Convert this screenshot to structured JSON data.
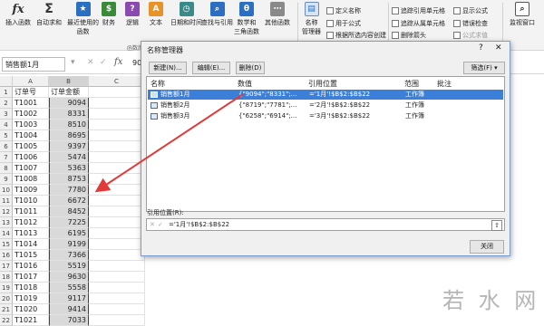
{
  "ribbon": {
    "insert_function": "插入函数",
    "autosum": "自动求和",
    "recent": "最近使用的\n函数",
    "financial": "财务",
    "logical": "逻辑",
    "text": "文本",
    "datetime": "日期和时间",
    "lookup": "查找与引用",
    "math": "数学和\n三角函数",
    "more": "其他函数",
    "name_manager": "名称\n管理器",
    "define_name": "定义名称",
    "use_in_formula": "用于公式",
    "create_from_selection": "根据所选内容创建",
    "trace_precedents": "追踪引用单元格",
    "trace_dependents": "追踪从属单元格",
    "remove_arrows": "删除箭头",
    "show_formulas": "显示公式",
    "error_checking": "错误检查",
    "evaluate_formula": "公式求值",
    "watch_window": "监视窗口",
    "group_library": "函数库",
    "fx": "fx",
    "sigma": "Σ"
  },
  "formula_bar": {
    "name_box": "销售额1月",
    "fx": "fx",
    "cancel": "✕",
    "enter": "✓",
    "value": "90"
  },
  "sheet": {
    "col_a": "A",
    "col_b": "B",
    "col_c": "C",
    "header_a": "订单号",
    "header_b": "订单金额",
    "rows": [
      {
        "id": "T1001",
        "amt": "9094"
      },
      {
        "id": "T1002",
        "amt": "8331"
      },
      {
        "id": "T1003",
        "amt": "8510"
      },
      {
        "id": "T1004",
        "amt": "8695"
      },
      {
        "id": "T1005",
        "amt": "9397"
      },
      {
        "id": "T1006",
        "amt": "5474"
      },
      {
        "id": "T1007",
        "amt": "5363"
      },
      {
        "id": "T1008",
        "amt": "8753"
      },
      {
        "id": "T1009",
        "amt": "7780"
      },
      {
        "id": "T1010",
        "amt": "6672"
      },
      {
        "id": "T1011",
        "amt": "8452"
      },
      {
        "id": "T1012",
        "amt": "7225"
      },
      {
        "id": "T1013",
        "amt": "6195"
      },
      {
        "id": "T1014",
        "amt": "9199"
      },
      {
        "id": "T1015",
        "amt": "7366"
      },
      {
        "id": "T1016",
        "amt": "5519"
      },
      {
        "id": "T1017",
        "amt": "9630"
      },
      {
        "id": "T1018",
        "amt": "5558"
      },
      {
        "id": "T1019",
        "amt": "9117"
      },
      {
        "id": "T1020",
        "amt": "9414"
      },
      {
        "id": "T1021",
        "amt": "7033"
      }
    ]
  },
  "dialog": {
    "title": "名称管理器",
    "help": "?",
    "close": "✕",
    "new": "新建(N)...",
    "edit": "编辑(E)...",
    "delete": "删除(D)",
    "filter": "筛选(F) ▾",
    "col_name": "名称",
    "col_value": "数值",
    "col_ref": "引用位置",
    "col_scope": "范围",
    "col_comment": "批注",
    "items": [
      {
        "name": "销售额1月",
        "value": "{\"9094\";\"8331\";...",
        "ref": "='1月'!$B$2:$B$22",
        "scope": "工作簿"
      },
      {
        "name": "销售额2月",
        "value": "{\"8719\";\"7781\";...",
        "ref": "='2月'!$B$2:$B$22",
        "scope": "工作簿"
      },
      {
        "name": "销售额3月",
        "value": "{\"6258\";\"6914\";...",
        "ref": "='3月'!$B$2:$B$22",
        "scope": "工作簿"
      }
    ],
    "ref_label": "引用位置(R):",
    "ref_value": "='1月'!$B$2:$B$22",
    "close_button": "关闭"
  },
  "watermark": "若 水 网",
  "colors": {
    "accent": "#3c7fd9",
    "arrow": "#e03a3a"
  }
}
